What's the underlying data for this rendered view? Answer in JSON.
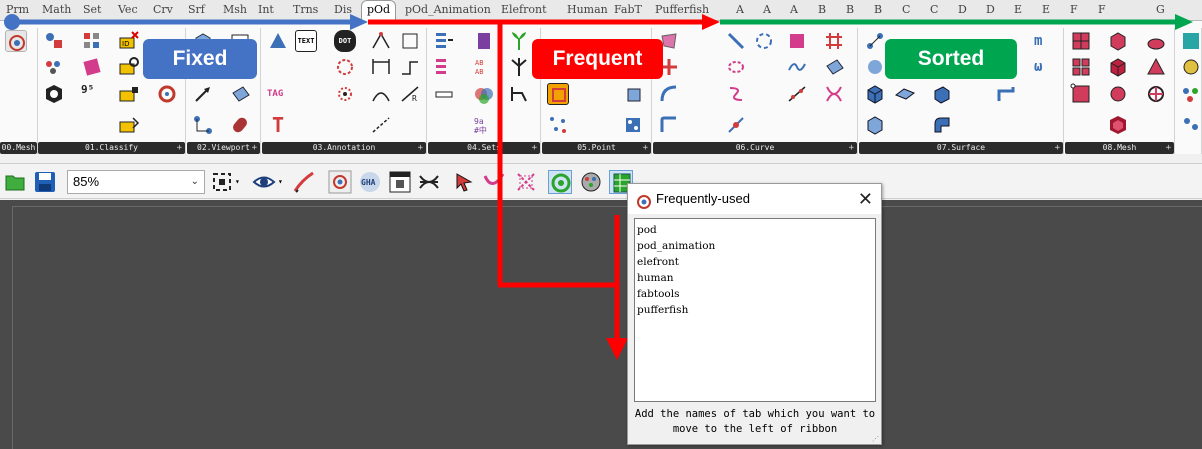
{
  "tabs": [
    "Prm",
    "Math",
    "Set",
    "Vec",
    "Crv",
    "Srf",
    "Msh",
    "Int",
    "Trns",
    "Dis",
    "pOd",
    "pOd_Animation",
    "Elefront",
    "Human",
    "FabT",
    "Pufferfish",
    "A",
    "A",
    "A",
    "B",
    "B",
    "B",
    "C",
    "C",
    "D",
    "D",
    "E",
    "E",
    "F",
    "F",
    "G"
  ],
  "active_tab": "pOd",
  "groups": [
    "00.Mesh",
    "01.Classify",
    "02.Viewport",
    "03.Annotation",
    "04.Sets",
    "05.Point",
    "06.Curve",
    "07.Surface",
    "08.Mesh"
  ],
  "ribbon_texts": {
    "dot": "DOT",
    "tag": "TAG",
    "text": "TEXT",
    "id": "ID",
    "num": "9⁵"
  },
  "toolbar": {
    "zoom": "85%"
  },
  "overlay": {
    "fixed": "Fixed",
    "frequent": "Frequent",
    "sorted": "Sorted"
  },
  "colors": {
    "fixed": "#4472c4",
    "frequent": "#ff0000",
    "sorted": "#00a550"
  },
  "dialog": {
    "title": "Frequently-used",
    "close": "✕",
    "items": [
      "pod",
      "pod_animation",
      "elefront",
      "human",
      "fabtools",
      "pufferfish"
    ],
    "footer": "Add the names of tab which you want to move to the left of ribbon"
  }
}
